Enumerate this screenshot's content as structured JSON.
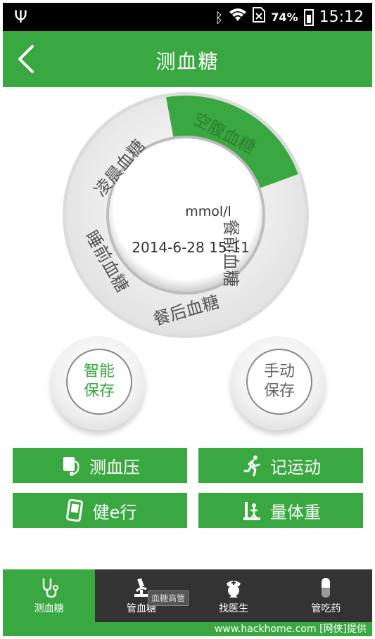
{
  "status_bar": {
    "battery": "74%",
    "time": "15:12"
  },
  "header": {
    "title": "测血糖"
  },
  "dial": {
    "segments": [
      {
        "label": "空腹血糖",
        "active": true
      },
      {
        "label": "餐前血糖",
        "active": false
      },
      {
        "label": "餐后血糖",
        "active": false
      },
      {
        "label": "睡前血糖",
        "active": false
      },
      {
        "label": "凌晨血糖",
        "active": false
      }
    ],
    "unit": "mmol/l",
    "datetime": "2014-6-28  15:11"
  },
  "save_buttons": {
    "smart": {
      "line1": "智能",
      "line2": "保存"
    },
    "manual": {
      "line1": "手动",
      "line2": "保存"
    }
  },
  "actions": [
    {
      "label": "测血压",
      "icon": "blood-pressure-icon"
    },
    {
      "label": "记运动",
      "icon": "running-icon"
    },
    {
      "label": "健e行",
      "icon": "pedometer-icon"
    },
    {
      "label": "量体重",
      "icon": "scale-icon"
    }
  ],
  "bottom_nav": [
    {
      "label": "测血糖",
      "icon": "stethoscope-icon",
      "active": true
    },
    {
      "label": "管血糖",
      "icon": "microscope-icon",
      "active": false
    },
    {
      "label": "找医生",
      "icon": "nurse-icon",
      "active": false
    },
    {
      "label": "管吃药",
      "icon": "pill-icon",
      "active": false
    }
  ],
  "tooltip": "血糖高管",
  "watermark": "www.hackhome.com [网侠]提供",
  "colors": {
    "accent": "#3aa841",
    "nav_bg": "#333333"
  }
}
